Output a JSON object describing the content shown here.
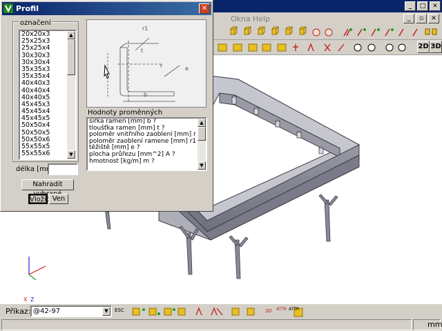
{
  "app": {
    "menu_items": [
      "Okna",
      "Help"
    ],
    "toolbar_row2_labels": [
      "2D",
      "3D"
    ]
  },
  "dialog": {
    "title": "Profil",
    "designation_label": "označení",
    "profiles": [
      "20x20x3",
      "25x25x3",
      "25x25x4",
      "30x30x3",
      "30x30x4",
      "35x35x3",
      "35x35x4",
      "40x40x3",
      "40x40x4",
      "40x40x5",
      "45x45x3",
      "45x45x4",
      "45x45x5",
      "50x50x4",
      "50x50x5",
      "50x50x6",
      "55x55x5",
      "55x55x6"
    ],
    "diagram_labels": {
      "r1": "r1",
      "t": "t",
      "r": "r",
      "e": "e",
      "b": "b"
    },
    "values_label": "Hodnoty proměnných",
    "variables": [
      "šířka ramen [mm] b ?",
      "tloušťka ramen [mm] t ?",
      "poloměr vnitřního zaoblení [mm] r ?",
      "poloměr zaoblení ramene [mm] r1 ?",
      "těžiště [mm] e ?",
      "plocha průřezu [mm^2] A ?",
      "hmotnost [kg/m] m ?"
    ],
    "length_label": "délka [mm]",
    "length_value": "",
    "replace_button": "Nahradit vybrané",
    "insert_button": "Vložit",
    "exit_button": "Ven"
  },
  "axes": {
    "x": "X",
    "z": "Z"
  },
  "command": {
    "label": "Příkaz:",
    "value": "@42-97",
    "esc": "ESC",
    "toolbar_labels": [
      "3D",
      "ATTR",
      "ATTR"
    ]
  },
  "status": {
    "units": "mm"
  },
  "colors": {
    "title_blue": "#0a246a",
    "chrome": "#d4d0c8",
    "frame": "#8a8a96"
  }
}
